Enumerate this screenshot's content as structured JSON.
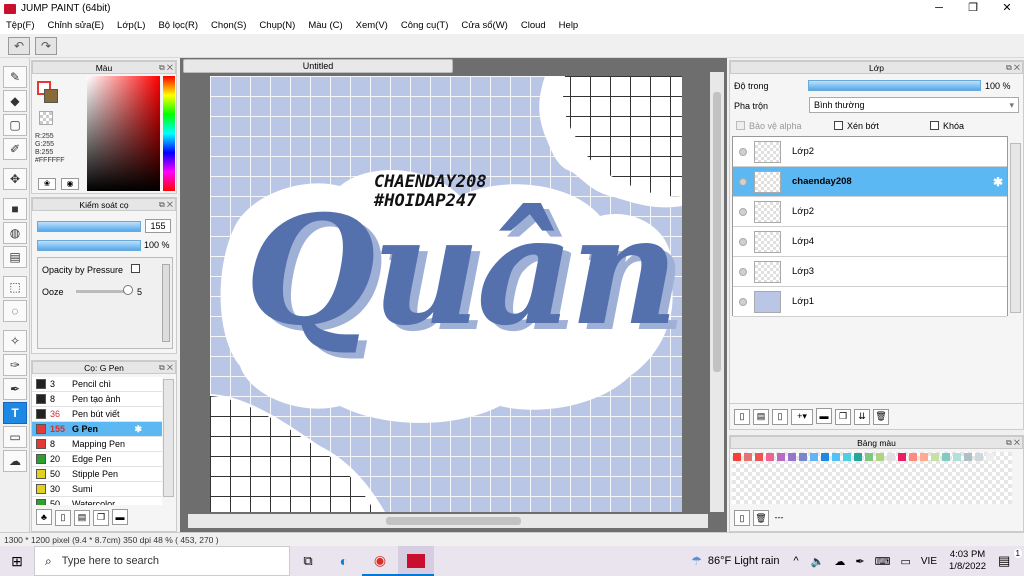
{
  "window": {
    "title": "JUMP PAINT (64bit)",
    "min": "─",
    "max": "❐",
    "close": "✕"
  },
  "menu": [
    "Tệp(F)",
    "Chỉnh sửa(E)",
    "Lớp(L)",
    "Bộ lọc(R)",
    "Chọn(S)",
    "Chụp(N)",
    "Màu (C)",
    "Xem(V)",
    "Công cụ(T)",
    "Cửa sổ(W)",
    "Cloud",
    "Help"
  ],
  "color_panel": {
    "title": "Màu",
    "r": "R:255",
    "g": "G:255",
    "b": "B:255",
    "hex": "#FFFFFF"
  },
  "brush_control": {
    "title": "Kiểm soát cọ",
    "size": "155",
    "opacity": "100 %",
    "opacity_pressure": "Opacity by Pressure",
    "ooze_label": "Ooze",
    "ooze_value": "5"
  },
  "brushes": {
    "title": "Cọ: G Pen",
    "items": [
      {
        "size": "3",
        "name": "Pencil chì",
        "color": "#222222",
        "selected": false,
        "red": false
      },
      {
        "size": "8",
        "name": "Pen tạo ảnh",
        "color": "#222222",
        "selected": false,
        "red": false
      },
      {
        "size": "36",
        "name": "Pen bút viết",
        "color": "#222222",
        "selected": false,
        "red": true
      },
      {
        "size": "155",
        "name": "G Pen",
        "color": "#e53935",
        "selected": true,
        "red": true
      },
      {
        "size": "8",
        "name": "Mapping Pen",
        "color": "#e53935",
        "selected": false,
        "red": false
      },
      {
        "size": "20",
        "name": "Edge Pen",
        "color": "#2e9e2e",
        "selected": false,
        "red": false
      },
      {
        "size": "50",
        "name": "Stipple Pen",
        "color": "#e3d21b",
        "selected": false,
        "red": false
      },
      {
        "size": "30",
        "name": "Sumi",
        "color": "#e3d21b",
        "selected": false,
        "red": false
      },
      {
        "size": "50",
        "name": "Watercolor",
        "color": "#2e9e2e",
        "selected": false,
        "red": false
      }
    ]
  },
  "canvas": {
    "tab": "Untitled",
    "text_line1": "CHAENDAY208",
    "text_line2": "#HOIDAP247",
    "art_text": "Quân"
  },
  "layers_panel": {
    "title": "Lớp",
    "opacity_label": "Độ trong",
    "opacity_value": "100 %",
    "blend_label": "Pha trộn",
    "blend_value": "Bình thường",
    "protect_alpha": "Bảo vệ alpha",
    "clipping": "Xén bớt",
    "lock": "Khóa",
    "layers": [
      {
        "name": "Lớp2",
        "selected": false
      },
      {
        "name": "chaenday208",
        "selected": true
      },
      {
        "name": "Lớp2",
        "selected": false
      },
      {
        "name": "Lớp4",
        "selected": false
      },
      {
        "name": "Lớp3",
        "selected": false
      },
      {
        "name": "Lớp1",
        "selected": false
      }
    ]
  },
  "palette": {
    "title": "Bảng màu",
    "footer": "---",
    "colors": [
      "#f44336",
      "#e57373",
      "#ef5350",
      "#f06292",
      "#ba68c8",
      "#9575cd",
      "#7986cb",
      "#64b5f6",
      "#1e88e5",
      "#4fc3f7",
      "#4dd0e1",
      "#26a69a",
      "#81c784",
      "#aed581",
      "#e0e0e0",
      "#e91e63",
      "#ff8a80",
      "#ffab91",
      "#c5e1a5",
      "#80cbc4",
      "#b2dfdb",
      "#b0bec5",
      "#cfd8dc",
      "#eeeeee"
    ]
  },
  "status": {
    "size": "1300 * 1200 pixel",
    "cm": "(9.4 * 8.7cm)",
    "dpi": "350 dpi",
    "zoom": "48 %",
    "coord": "( 453, 270 )"
  },
  "taskbar": {
    "search": "Type here to search",
    "weather": "86°F  Light rain",
    "lang": "VIE",
    "time": "4:03 PM",
    "date": "1/8/2022",
    "badge": "1"
  }
}
